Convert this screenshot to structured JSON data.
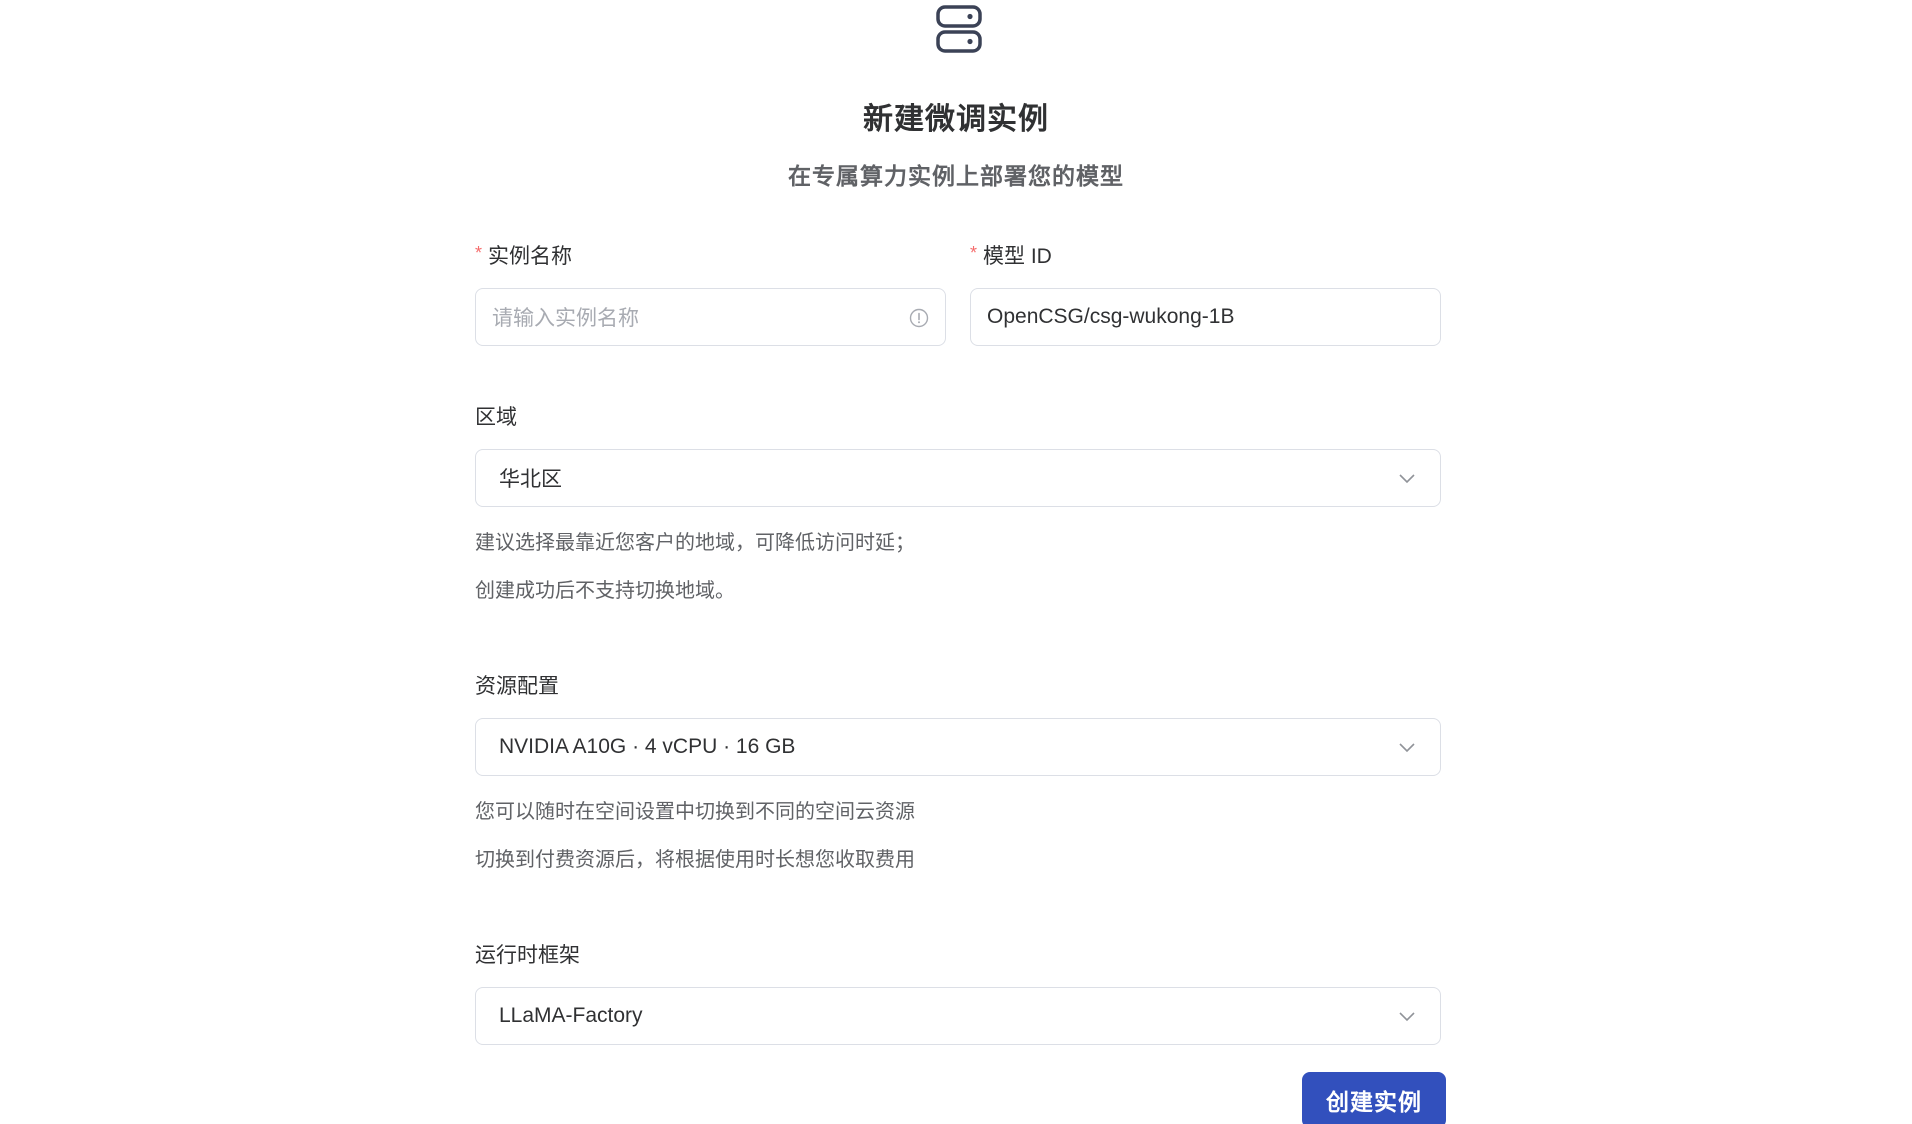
{
  "header": {
    "title": "新建微调实例",
    "subtitle": "在专属算力实例上部署您的模型",
    "icon": "server-icon"
  },
  "form": {
    "instance_name": {
      "label": "实例名称",
      "required_mark": "*",
      "placeholder": "请输入实例名称",
      "value": ""
    },
    "model_id": {
      "label": "模型 ID",
      "required_mark": "*",
      "value": "OpenCSG/csg-wukong-1B"
    },
    "region": {
      "label": "区域",
      "selected": "华北区",
      "help": [
        "建议选择最靠近您客户的地域，可降低访问时延；",
        "创建成功后不支持切换地域。"
      ]
    },
    "resource": {
      "label": "资源配置",
      "selected": "NVIDIA A10G · 4 vCPU · 16 GB",
      "help": [
        "您可以随时在空间设置中切换到不同的空间云资源",
        "切换到付费资源后，将根据使用时长想您收取费用"
      ]
    },
    "runtime": {
      "label": "运行时框架",
      "selected": "LLaMA-Factory"
    },
    "submit_label": "创建实例"
  },
  "colors": {
    "primary": "#3250bd",
    "required": "#f56c6c",
    "border": "#dcdfe6",
    "text": "#303133",
    "muted": "#606266"
  }
}
